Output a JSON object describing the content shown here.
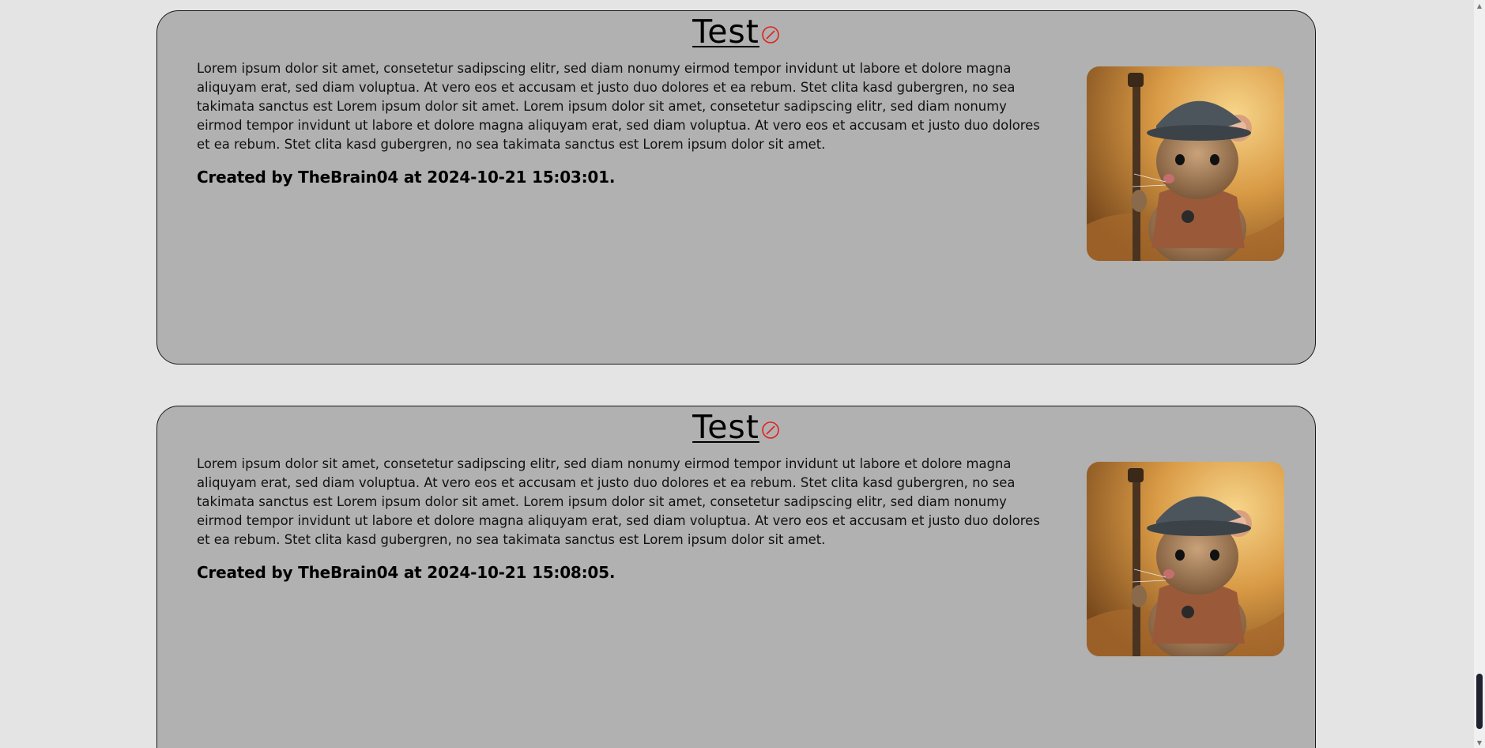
{
  "posts": [
    {
      "title": "Test",
      "body": "Lorem ipsum dolor sit amet, consetetur sadipscing elitr, sed diam nonumy eirmod tempor invidunt ut labore et dolore magna aliquyam erat, sed diam voluptua. At vero eos et accusam et justo duo dolores et ea rebum. Stet clita kasd gubergren, no sea takimata sanctus est Lorem ipsum dolor sit amet. Lorem ipsum dolor sit amet, consetetur sadipscing elitr, sed diam nonumy eirmod tempor invidunt ut labore et dolore magna aliquyam erat, sed diam voluptua. At vero eos et accusam et justo duo dolores et ea rebum. Stet clita kasd gubergren, no sea takimata sanctus est Lorem ipsum dolor sit amet.",
      "meta": "Created by TheBrain04 at 2024-10-21 15:03:01.",
      "delete_icon": "prohibit-icon",
      "image_icon": "mouse-wanderer-image"
    },
    {
      "title": "Test",
      "body": "Lorem ipsum dolor sit amet, consetetur sadipscing elitr, sed diam nonumy eirmod tempor invidunt ut labore et dolore magna aliquyam erat, sed diam voluptua. At vero eos et accusam et justo duo dolores et ea rebum. Stet clita kasd gubergren, no sea takimata sanctus est Lorem ipsum dolor sit amet. Lorem ipsum dolor sit amet, consetetur sadipscing elitr, sed diam nonumy eirmod tempor invidunt ut labore et dolore magna aliquyam erat, sed diam voluptua. At vero eos et accusam et justo duo dolores et ea rebum. Stet clita kasd gubergren, no sea takimata sanctus est Lorem ipsum dolor sit amet.",
      "meta": "Created by TheBrain04 at 2024-10-21 15:08:05.",
      "delete_icon": "prohibit-icon",
      "image_icon": "mouse-wanderer-image"
    }
  ],
  "colors": {
    "page_background": "#e4e4e4",
    "card_background": "#b1b1b1",
    "card_border": "#1a1a1a",
    "delete_icon": "#e02020",
    "scroll_thumb": "#20222f"
  }
}
